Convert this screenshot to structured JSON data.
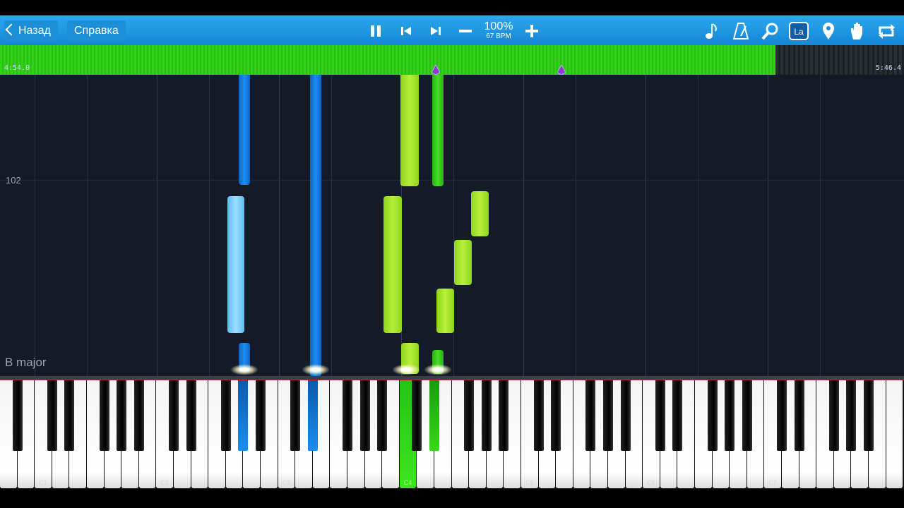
{
  "toolbar": {
    "back_label": "Назад",
    "help_label": "Справка",
    "speed_percent": "100%",
    "bpm": "67 BPM",
    "icons": [
      "pause-icon",
      "skip-back-icon",
      "skip-forward-icon",
      "minus-icon",
      "plus-icon",
      "note-icon",
      "metronome-icon",
      "magnifier-icon",
      "la-key-icon",
      "location-pin-icon",
      "hand-icon",
      "loop-icon"
    ],
    "la_label": "La"
  },
  "timeline": {
    "start_time": "4:54.0",
    "end_time": "5:46.4",
    "played_fraction": 0.858,
    "colors": {
      "played": "#33d21a",
      "marker": "#8a3fd0"
    }
  },
  "roll": {
    "measure_number": "102",
    "key_signature": "B major",
    "colors": {
      "background": "#141a26",
      "dark_blue": "#1478d8",
      "light_blue": "#7ccfff",
      "light_green": "#a8e628",
      "green": "#3ccf1e"
    }
  },
  "keyboard": {
    "octave_labels": [
      "C1",
      "C2",
      "C3",
      "C4",
      "C5",
      "C6",
      "C7"
    ],
    "pressed": [
      "C4"
    ]
  }
}
